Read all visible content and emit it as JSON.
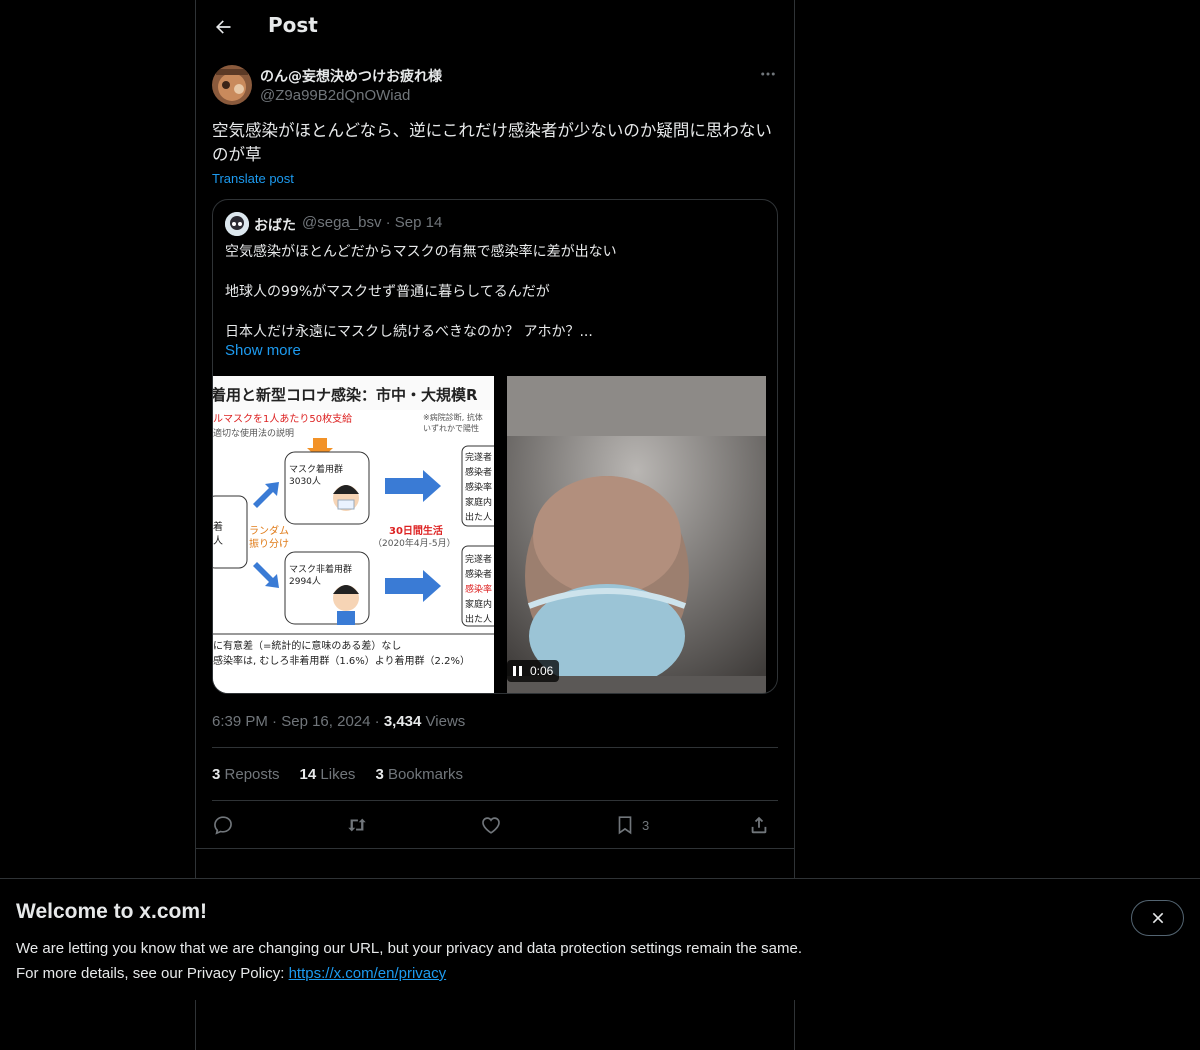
{
  "header": {
    "title": "Post",
    "back_icon": "arrow-left-icon"
  },
  "post": {
    "author_name": "のん@妄想決めつけお疲れ様",
    "author_handle": "@Z9a99B2dQnOWiad",
    "text": "空気感染がほとんどなら、逆にこれだけ感染者が少ないのか疑問に思わないのが草",
    "translate_label": "Translate post",
    "time": "6:39 PM",
    "date": "Sep 16, 2024",
    "views_count": "3,434",
    "views_label": "Views"
  },
  "quote": {
    "author_name": "おばた",
    "author_handle": "@sega_bsv",
    "date": "Sep 14",
    "lines": [
      "空気感染がほとんどだからマスクの有無で感染率に差が出ない",
      "地球人の99%がマスクせず普通に暮らしてるんだが",
      "日本人だけ永遠にマスクし続けるべきなのか？ アホか？..."
    ],
    "show_more": "Show more",
    "image_left": {
      "heading": "着用と新型コロナ感染：市中・大規模R",
      "note1": "ルマスクを1人あたり50枚支給",
      "note2": "適切な使用法の説明",
      "note3": "※病院診断, 抗体",
      "note4": "いずれかで陽性",
      "group1": "マスク着用群",
      "group1_count": "3030人",
      "group2": "マスク非着用群",
      "group2_count": "2994人",
      "random": "ランダム",
      "random2": "振り分け",
      "left_label": "着",
      "left_label2": "人",
      "period": "30日間生活",
      "period_dates": "（2020年4月-5月）",
      "right1": [
        "完遂者",
        "感染者",
        "感染率",
        "家庭内",
        "出た人"
      ],
      "right2": [
        "完遂者",
        "感染者",
        "感染率",
        "家庭内",
        "出た人"
      ],
      "footer1": "に有意差（=統計的に意味のある差）なし",
      "footer2": "感染率は, むしろ非着用群（1.6%）より着用群（2.2%）"
    },
    "video_time": "0:06"
  },
  "stats": {
    "reposts_count": "3",
    "reposts_label": "Reposts",
    "likes_count": "14",
    "likes_label": "Likes",
    "bookmarks_count": "3",
    "bookmarks_label": "Bookmarks"
  },
  "actions": {
    "reply_icon": "reply-icon",
    "repost_icon": "repost-icon",
    "like_icon": "heart-icon",
    "bookmark_icon": "bookmark-icon",
    "bookmark_count": "3",
    "share_icon": "share-icon"
  },
  "banner": {
    "title": "Welcome to x.com!",
    "line1": "We are letting you know that we are changing our URL, but your privacy and data protection settings remain the same.",
    "line2_prefix": "For more details, see our Privacy Policy: ",
    "link": "https://x.com/en/privacy"
  },
  "colors": {
    "background": "#000000",
    "text": "#e7e9ea",
    "muted": "#71767b",
    "accent": "#1d9bf0",
    "border": "#2f3336"
  }
}
